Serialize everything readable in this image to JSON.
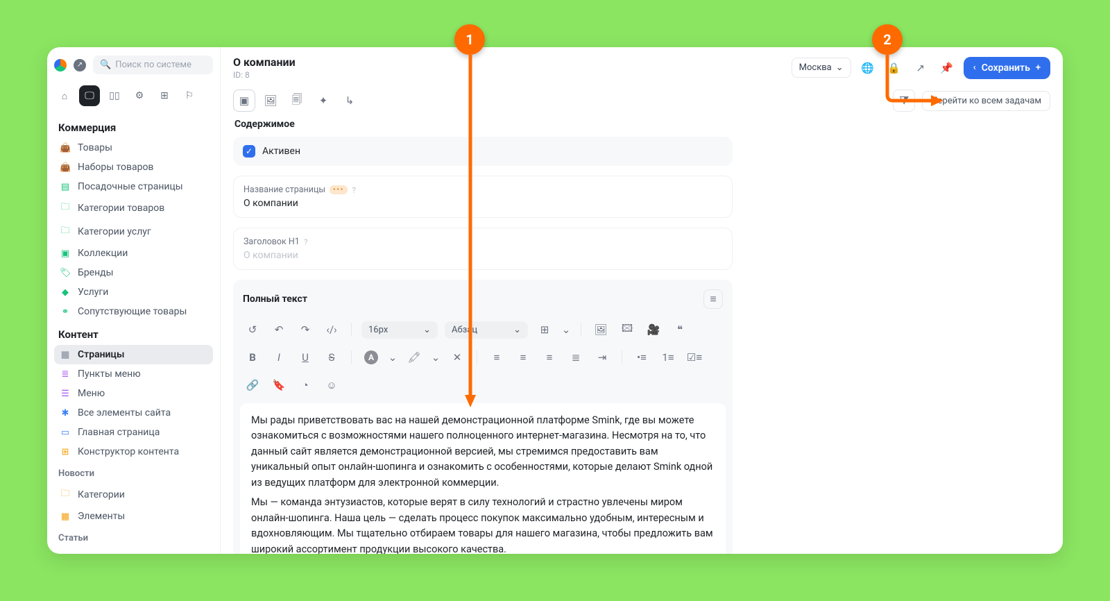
{
  "search": {
    "placeholder": "Поиск по системе"
  },
  "sidebar": {
    "groups": [
      {
        "title": "Коммерция",
        "items": [
          {
            "label": "Товары"
          },
          {
            "label": "Наборы товаров"
          },
          {
            "label": "Посадочные страницы"
          },
          {
            "label": "Категории товаров"
          },
          {
            "label": "Категории услуг"
          },
          {
            "label": "Коллекции"
          },
          {
            "label": "Бренды"
          },
          {
            "label": "Услуги"
          },
          {
            "label": "Сопутствующие товары"
          }
        ]
      },
      {
        "title": "Контент",
        "items": [
          {
            "label": "Страницы"
          },
          {
            "label": "Пункты меню"
          },
          {
            "label": "Меню"
          },
          {
            "label": "Все элементы сайта"
          },
          {
            "label": "Главная страница"
          },
          {
            "label": "Конструктор контента"
          }
        ]
      },
      {
        "title": "Новости",
        "small": true,
        "items": [
          {
            "label": "Категории"
          },
          {
            "label": "Элементы"
          }
        ]
      },
      {
        "title": "Статьи",
        "small": true,
        "items": []
      }
    ]
  },
  "header": {
    "title": "О компании",
    "id_label": "ID: 8",
    "city": "Москва",
    "save_label": "Сохранить",
    "tasks_button": "Перейти ко всем задачам"
  },
  "content": {
    "section_label": "Содержимое",
    "active_label": "Активен",
    "name_field_label": "Название страницы",
    "name_field_value": "О компании",
    "h1_field_label": "Заголовок H1",
    "h1_field_placeholder": "О компании"
  },
  "editor": {
    "title": "Полный текст",
    "font_size": "16px",
    "block_type": "Абзац",
    "paragraphs": [
      "Мы рады приветствовать вас на нашей демонстрационной платформе Smink, где вы можете ознакомиться с возможностями нашего полноценного интернет-магазина.  Несмотря на то, что данный сайт является демонстрационной версией, мы стремимся предоставить вам уникальный опыт онлайн-шопинга и ознакомить с особенностями, которые делают Smink одной из ведущих платформ для электронной коммерции.",
      "Мы — команда энтузиастов, которые верят в силу технологий и страстно увлечены миром онлайн-шопинга.  Наша цель — сделать процесс покупок максимально удобным, интересным и вдохновляющим.  Мы тщательно отбираем товары для нашего магазина, чтобы предложить вам широкий ассортимент продукции высокого качества."
    ]
  },
  "annotations": {
    "badge1": "1",
    "badge2": "2"
  },
  "colors": {
    "accent": "#2f6fed",
    "annotation": "#ff6a00"
  }
}
